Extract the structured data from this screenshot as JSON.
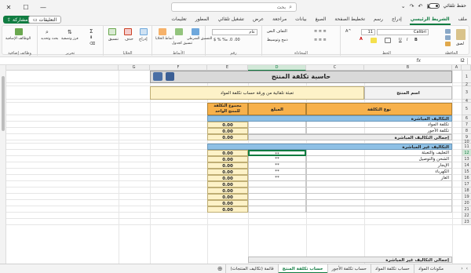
{
  "titlebar": {
    "autosave_label": "حفظ تلقائي",
    "search_placeholder": "بحث"
  },
  "menu": {
    "tabs": [
      "ملف",
      "الشريط الرئيسي",
      "إدراج",
      "رسم",
      "تخطيط الصفحة",
      "الصيغ",
      "بيانات",
      "مراجعة",
      "عرض",
      "تشغيل تلقائي",
      "المطور",
      "تعليمات"
    ],
    "active_tab": "الشريط الرئيسي",
    "share_label": "مشاركة",
    "comments_label": "التعليقات"
  },
  "ribbon": {
    "groups": [
      "الحافظة",
      "الخط",
      "المحاذاة",
      "رقم",
      "الأنماط",
      "الخلايا",
      "تحرير",
      "وظائف إضافية"
    ],
    "font_name": "Calibri",
    "font_size": "11",
    "number_format": "عام",
    "paste_label": "لصق",
    "conditional_format_label": "التنسيق الشرطي",
    "format_as_table_label": "تنسيق كجدول",
    "cell_styles_label": "أنماط الخلايا",
    "insert_label": "إدراج",
    "delete_label": "حذف",
    "format_label": "تنسيق",
    "sort_filter_label": "فرز وتصفية",
    "find_select_label": "بحث وتحديد",
    "addins_label": "الوظائف الإضافية",
    "wrap_text_label": "التفاف النص",
    "merge_label": "دمج وتوسيط"
  },
  "formula_bar": {
    "name_box": "I2",
    "fx": "fx",
    "formula": ""
  },
  "columns": [
    "A",
    "B",
    "C",
    "D",
    "E",
    "F",
    "G"
  ],
  "selected_column": "D",
  "rows": [
    "1",
    "2",
    "3",
    "4",
    "5",
    "6",
    "7",
    "8",
    "9",
    "10",
    "11",
    "12",
    "13",
    "14",
    "15",
    "16",
    "17",
    "18",
    "19",
    "20",
    "21",
    "22",
    "23"
  ],
  "selected_row": "12",
  "sheet": {
    "title": "حاسبة تكلفة المنتج",
    "product_name_label": "اسم المنتج",
    "product_name_value": "تعبئة تلقائية من ورقة حساب تكلفة المواد",
    "headers": {
      "cost_type": "نوع التكلفة",
      "amount": "المبلغ",
      "total_per_unit": "مجموع التكلفة للمنتج الواحد"
    },
    "direct_section": "التكاليف المباشرة",
    "direct_rows": [
      {
        "label": "تكلفة المواد",
        "value": "0.00"
      },
      {
        "label": "تكلفة الأجور",
        "value": "0.00"
      }
    ],
    "direct_total_label": "إجمالي التكاليف المباشرة",
    "direct_total_value": "0.00",
    "indirect_section": "التكاليف غير المباشرة",
    "indirect_rows": [
      {
        "label": "التغليف والتعبئة",
        "amount": "**",
        "value": "0.00"
      },
      {
        "label": "الشحن والتوصيل",
        "amount": "**",
        "value": "0.00"
      },
      {
        "label": "الإيجار",
        "amount": "**",
        "value": "0.00"
      },
      {
        "label": "الكهرباء",
        "amount": "**",
        "value": "0.00"
      },
      {
        "label": "الغاز",
        "amount": "**",
        "value": "0.00"
      },
      {
        "label": "",
        "amount": "",
        "value": "0.00"
      },
      {
        "label": "",
        "amount": "",
        "value": "0.00"
      },
      {
        "label": "",
        "amount": "",
        "value": "0.00"
      },
      {
        "label": "",
        "amount": "",
        "value": "0.00"
      },
      {
        "label": "",
        "amount": "",
        "value": "0.00"
      }
    ],
    "indirect_total_label": "إجمالي التكاليف غير المباشرة"
  },
  "sheet_tabs": [
    "مكونات المواد",
    "حساب تكلفة المواد",
    "حساب تكلفة الأجور",
    "حساب تكلفة المنتج",
    "قائمة (تكاليف المنتجات)"
  ],
  "active_sheet_tab": "حساب تكلفة المنتج",
  "colors": {
    "accent": "#107c41",
    "title_band": "#d9d9d9",
    "yellow": "#fdf2c8",
    "orange": "#f7b14b",
    "blue": "#8ec0e5"
  }
}
